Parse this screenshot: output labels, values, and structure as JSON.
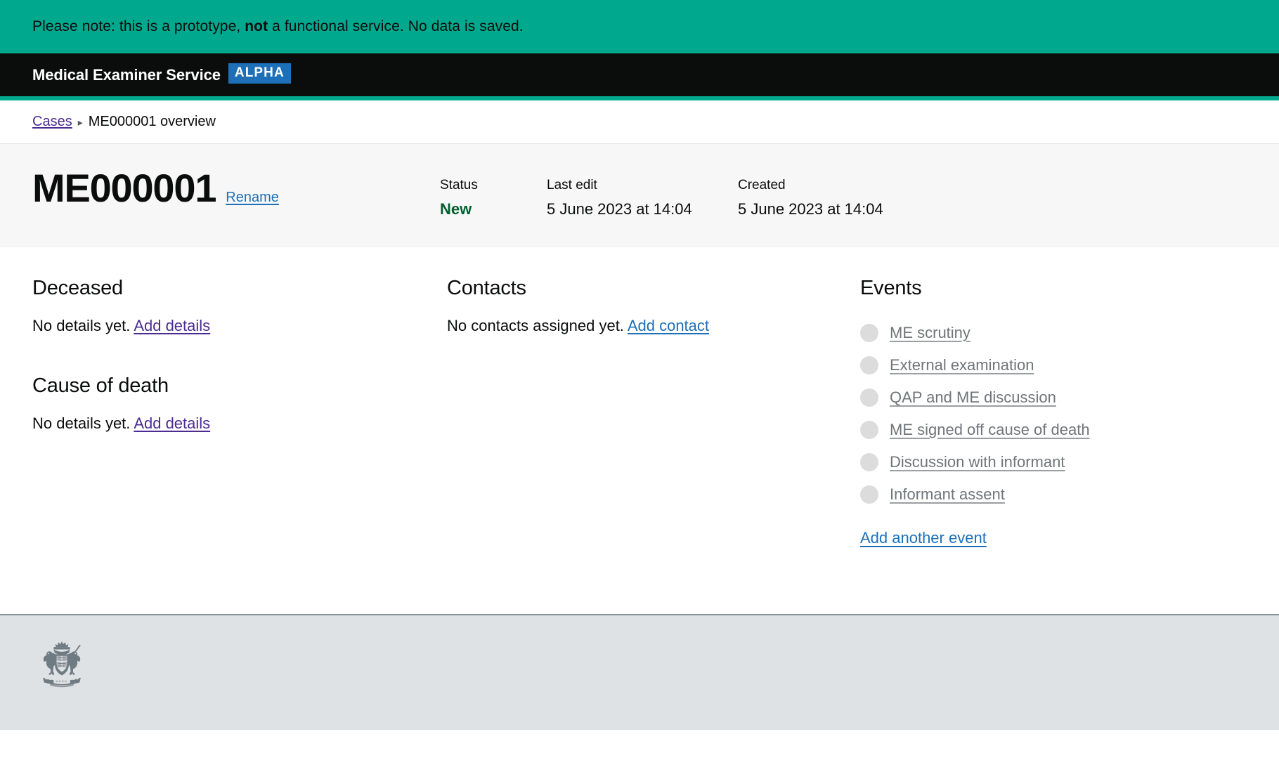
{
  "banner": {
    "text_before": "Please note: this is a prototype, ",
    "text_bold": "not",
    "text_after": " a functional service. No data is saved.",
    "background_color": "#00a88e"
  },
  "header": {
    "service_name": "Medical Examiner Service",
    "phase_tag": "ALPHA",
    "phase_tag_color": "#1d70b8",
    "background_color": "#0b0c0c"
  },
  "breadcrumb": {
    "parent_label": "Cases",
    "separator": "▸",
    "current_label": "ME000001 overview"
  },
  "case_header": {
    "case_id": "ME000001",
    "rename_label": "Rename",
    "meta": [
      {
        "label": "Status",
        "value": "New",
        "value_color": "#00602f"
      },
      {
        "label": "Last edit",
        "value": "5 June 2023 at 14:04"
      },
      {
        "label": "Created",
        "value": "5 June 2023 at 14:04"
      }
    ]
  },
  "deceased": {
    "heading": "Deceased",
    "empty_text": "No details yet.",
    "add_link": "Add details"
  },
  "cause_of_death": {
    "heading": "Cause of death",
    "empty_text": "No details yet.",
    "add_link": "Add details"
  },
  "contacts": {
    "heading": "Contacts",
    "empty_text": "No contacts assigned yet.",
    "add_link": "Add contact"
  },
  "events": {
    "heading": "Events",
    "items": [
      {
        "label": "ME scrutiny",
        "status": "incomplete"
      },
      {
        "label": "External examination",
        "status": "incomplete"
      },
      {
        "label": "QAP and ME discussion",
        "status": "incomplete"
      },
      {
        "label": "ME signed off cause of death",
        "status": "incomplete"
      },
      {
        "label": "Discussion with informant",
        "status": "incomplete"
      },
      {
        "label": "Informant assent",
        "status": "incomplete"
      }
    ],
    "add_link": "Add another event",
    "dot_color": "#dcdcdc"
  },
  "footer": {
    "crest_name": "royal-coat-of-arms"
  }
}
